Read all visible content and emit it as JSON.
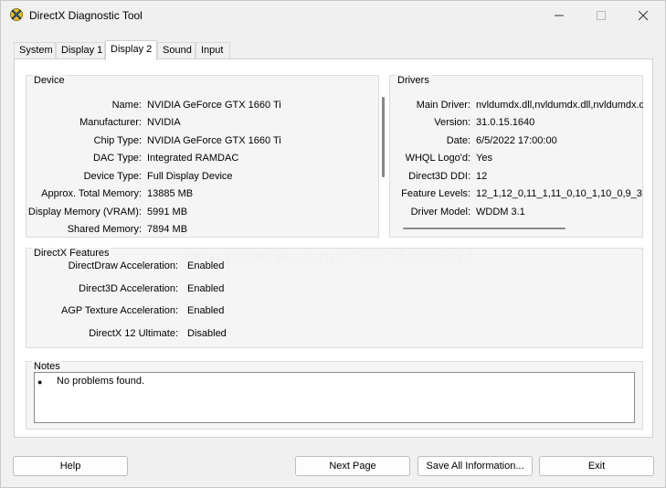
{
  "window": {
    "title": "DirectX Diagnostic Tool"
  },
  "tabs": [
    "System",
    "Display 1",
    "Display 2",
    "Sound",
    "Input"
  ],
  "active_tab": "Display 2",
  "device": {
    "title": "Device",
    "rows": [
      {
        "label": "Name:",
        "value": "NVIDIA GeForce GTX 1660 Ti"
      },
      {
        "label": "Manufacturer:",
        "value": "NVIDIA"
      },
      {
        "label": "Chip Type:",
        "value": "NVIDIA GeForce GTX 1660 Ti"
      },
      {
        "label": "DAC Type:",
        "value": "Integrated RAMDAC"
      },
      {
        "label": "Device Type:",
        "value": "Full Display Device"
      },
      {
        "label": "Approx. Total Memory:",
        "value": "13885 MB"
      },
      {
        "label": "Display Memory (VRAM):",
        "value": "5991 MB"
      },
      {
        "label": "Shared Memory:",
        "value": "7894 MB"
      }
    ]
  },
  "drivers": {
    "title": "Drivers",
    "rows": [
      {
        "label": "Main Driver:",
        "value": "nvldumdx.dll,nvldumdx.dll,nvldumdx.dll"
      },
      {
        "label": "Version:",
        "value": "31.0.15.1640"
      },
      {
        "label": "Date:",
        "value": "6/5/2022 17:00:00"
      },
      {
        "label": "WHQL Logo'd:",
        "value": "Yes"
      },
      {
        "label": "Direct3D DDI:",
        "value": "12"
      },
      {
        "label": "Feature Levels:",
        "value": "12_1,12_0,11_1,11_0,10_1,10_0,9_3"
      },
      {
        "label": "Driver Model:",
        "value": "WDDM 3.1"
      }
    ]
  },
  "features": {
    "title": "DirectX Features",
    "rows": [
      {
        "label": "DirectDraw Acceleration:",
        "value": "Enabled"
      },
      {
        "label": "Direct3D Acceleration:",
        "value": "Enabled"
      },
      {
        "label": "AGP Texture Acceleration:",
        "value": "Enabled"
      },
      {
        "label": "DirectX 12 Ultimate:",
        "value": "Disabled"
      }
    ]
  },
  "notes": {
    "title": "Notes",
    "items": [
      "No problems found."
    ]
  },
  "buttons": {
    "help": "Help",
    "next_page": "Next Page",
    "save_all": "Save All Information...",
    "exit": "Exit"
  },
  "watermark": "www.khmer24.com/p7282160508186",
  "icons": {
    "app": "directx-icon",
    "minimize": "minimize-icon",
    "maximize": "maximize-icon",
    "close": "close-icon"
  }
}
